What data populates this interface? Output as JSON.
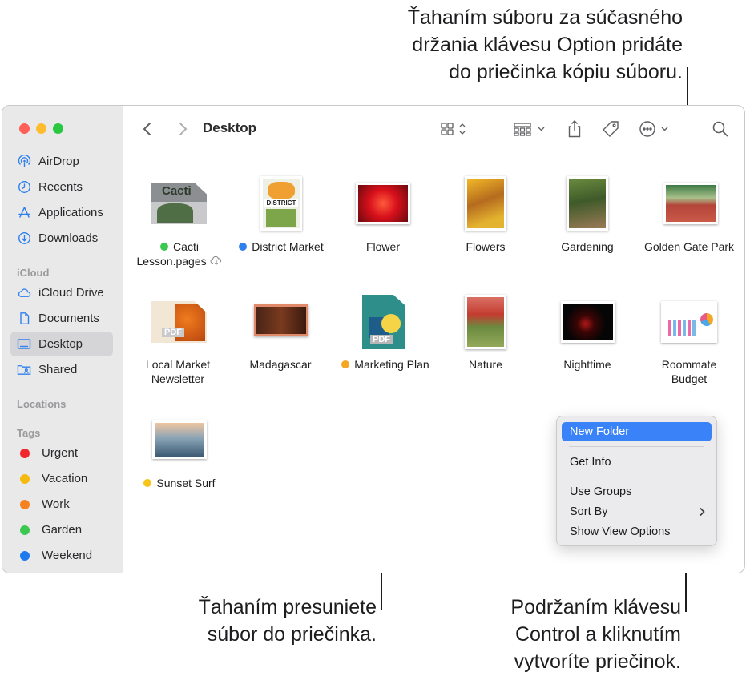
{
  "callouts": {
    "option_drag": [
      "Ťahaním súboru za súčasného",
      "držania klávesu Option pridáte",
      "do priečinka kópiu súboru."
    ],
    "drag_move": [
      "Ťahaním presuniete",
      "súbor do priečinka."
    ],
    "control_click": [
      "Podržaním klávesu",
      "Control a kliknutím",
      "vytvoríte priečinok."
    ]
  },
  "window": {
    "title": "Desktop"
  },
  "sidebar": {
    "favorites": [
      {
        "label": "AirDrop",
        "icon": "airdrop-icon"
      },
      {
        "label": "Recents",
        "icon": "clock-icon"
      },
      {
        "label": "Applications",
        "icon": "applications-icon"
      },
      {
        "label": "Downloads",
        "icon": "download-icon"
      }
    ],
    "icloud_header": "iCloud",
    "icloud": [
      {
        "label": "iCloud Drive",
        "icon": "cloud-icon"
      },
      {
        "label": "Documents",
        "icon": "document-icon"
      },
      {
        "label": "Desktop",
        "icon": "desktop-icon",
        "selected": true
      },
      {
        "label": "Shared",
        "icon": "shared-folder-icon"
      }
    ],
    "locations_header": "Locations",
    "tags_header": "Tags",
    "tags": [
      {
        "label": "Urgent",
        "color": "#f0282d"
      },
      {
        "label": "Vacation",
        "color": "#f5b90f"
      },
      {
        "label": "Work",
        "color": "#f5821e"
      },
      {
        "label": "Garden",
        "color": "#3cc850"
      },
      {
        "label": "Weekend",
        "color": "#1e78f0"
      }
    ]
  },
  "files": [
    {
      "line1": "Cacti",
      "line2": "Lesson.pages",
      "tag_color": "#3cc850",
      "icloud": true
    },
    {
      "line1": "District Market",
      "line2": "",
      "tag_color": "#2f80ed"
    },
    {
      "line1": "Flower",
      "line2": ""
    },
    {
      "line1": "Flowers",
      "line2": ""
    },
    {
      "line1": "Gardening",
      "line2": ""
    },
    {
      "line1": "Golden Gate Park",
      "line2": ""
    },
    {
      "line1": "Local Market",
      "line2": "Newsletter"
    },
    {
      "line1": "Madagascar",
      "line2": ""
    },
    {
      "line1": "Marketing Plan",
      "line2": "",
      "tag_color": "#f5a623"
    },
    {
      "line1": "Nature",
      "line2": ""
    },
    {
      "line1": "Nighttime",
      "line2": ""
    },
    {
      "line1": "Roommate",
      "line2": "Budget"
    },
    {
      "line1": "Sunset Surf",
      "line2": "",
      "tag_color": "#f5c518"
    }
  ],
  "thumb_text": {
    "cacti": "Cacti",
    "district": "DISTRICT",
    "pdf": "PDF"
  },
  "context_menu": {
    "items": [
      "New Folder",
      "Get Info",
      "Use Groups",
      "Sort By",
      "Show View Options"
    ]
  }
}
